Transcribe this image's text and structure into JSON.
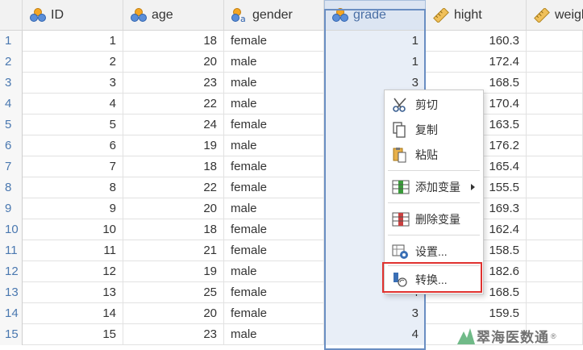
{
  "columns": [
    {
      "key": "id",
      "label": "ID",
      "icon": "nominal-icon"
    },
    {
      "key": "age",
      "label": "age",
      "icon": "nominal-icon"
    },
    {
      "key": "gender",
      "label": "gender",
      "icon": "nominal-text-icon"
    },
    {
      "key": "grade",
      "label": "grade",
      "icon": "nominal-icon"
    },
    {
      "key": "hight",
      "label": "hight",
      "icon": "ruler-icon"
    },
    {
      "key": "weight",
      "label": "weigh",
      "icon": "ruler-icon"
    }
  ],
  "rows": [
    {
      "n": "1",
      "id": "1",
      "age": "18",
      "gender": "female",
      "grade": "1",
      "hight": "160.3"
    },
    {
      "n": "2",
      "id": "2",
      "age": "20",
      "gender": "male",
      "grade": "1",
      "hight": "172.4"
    },
    {
      "n": "3",
      "id": "3",
      "age": "23",
      "gender": "male",
      "grade": "3",
      "hight": "168.5"
    },
    {
      "n": "4",
      "id": "4",
      "age": "22",
      "gender": "male",
      "grade": "",
      "hight": "170.4"
    },
    {
      "n": "5",
      "id": "5",
      "age": "24",
      "gender": "female",
      "grade": "",
      "hight": "163.5"
    },
    {
      "n": "6",
      "id": "6",
      "age": "19",
      "gender": "male",
      "grade": "",
      "hight": "176.2"
    },
    {
      "n": "7",
      "id": "7",
      "age": "18",
      "gender": "female",
      "grade": "",
      "hight": "165.4"
    },
    {
      "n": "8",
      "id": "8",
      "age": "22",
      "gender": "female",
      "grade": "",
      "hight": "155.5"
    },
    {
      "n": "9",
      "id": "9",
      "age": "20",
      "gender": "male",
      "grade": "",
      "hight": "169.3"
    },
    {
      "n": "10",
      "id": "10",
      "age": "18",
      "gender": "female",
      "grade": "",
      "hight": "162.4"
    },
    {
      "n": "11",
      "id": "11",
      "age": "21",
      "gender": "female",
      "grade": "",
      "hight": "158.5"
    },
    {
      "n": "12",
      "id": "12",
      "age": "19",
      "gender": "male",
      "grade": "",
      "hight": "182.6"
    },
    {
      "n": "13",
      "id": "13",
      "age": "25",
      "gender": "female",
      "grade": "4",
      "hight": "168.5"
    },
    {
      "n": "14",
      "id": "14",
      "age": "20",
      "gender": "female",
      "grade": "3",
      "hight": "159.5"
    },
    {
      "n": "15",
      "id": "15",
      "age": "23",
      "gender": "male",
      "grade": "4",
      "hight": ""
    }
  ],
  "context_menu": {
    "cut": "剪切",
    "copy": "复制",
    "paste": "粘贴",
    "add_variable": "添加变量",
    "delete_variable": "删除变量",
    "settings": "设置...",
    "transform": "转换..."
  },
  "watermark": {
    "text": "翠海医数通",
    "mark": "®"
  },
  "colors": {
    "selection_border": "#6a8ec2",
    "highlight_box": "#e0322f",
    "row_number": "#4a78b0"
  }
}
